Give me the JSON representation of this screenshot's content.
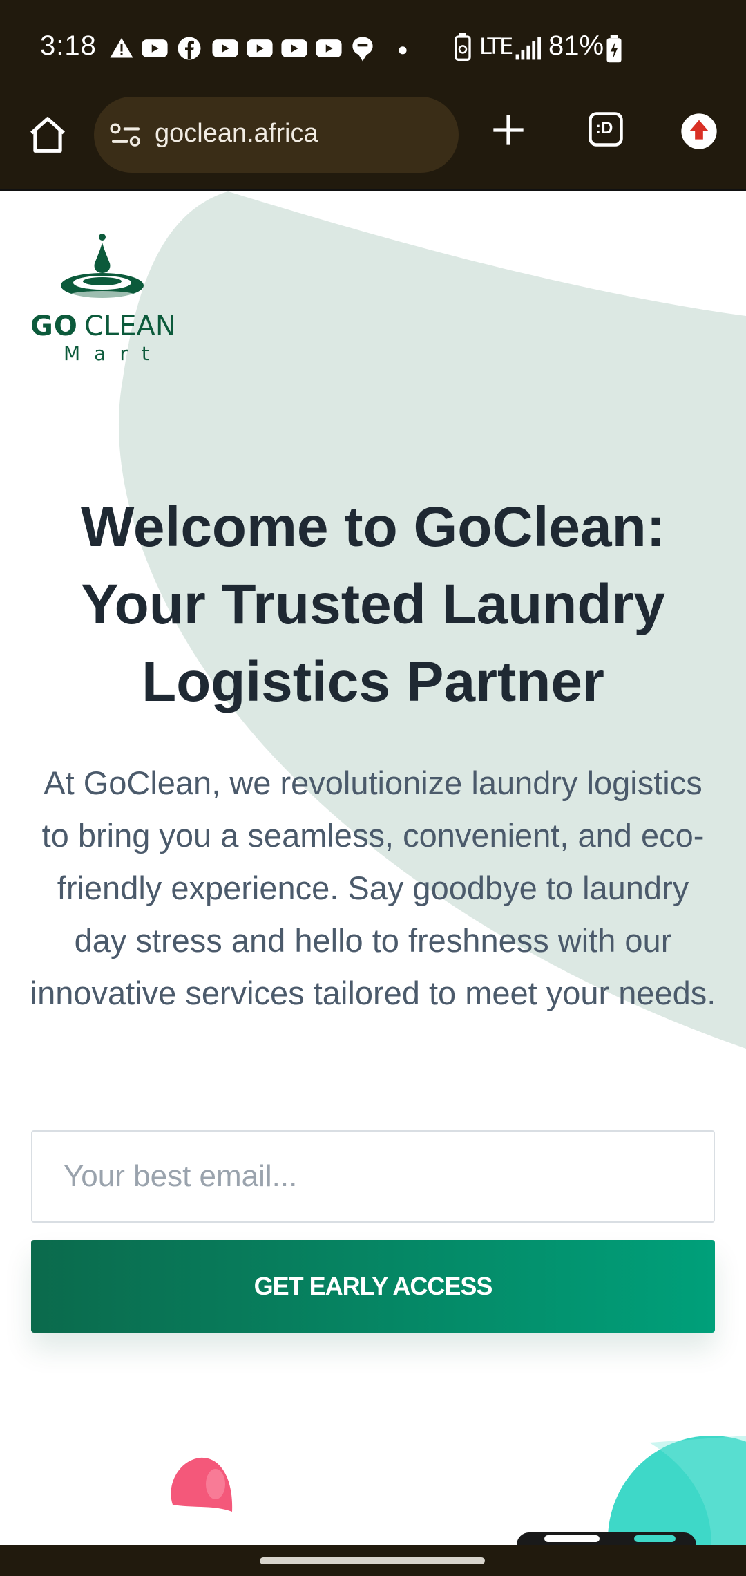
{
  "status_bar": {
    "time": "3:18",
    "notification_icons": [
      "warning-icon",
      "youtube-icon",
      "facebook-icon",
      "youtube-icon",
      "youtube-icon",
      "youtube-icon",
      "youtube-icon",
      "chat-icon",
      "more-dot-icon"
    ],
    "system_icons": [
      "battery-saver-icon",
      "lte-icon",
      "signal-icon",
      "battery-charging-icon"
    ],
    "network_label": "LTE",
    "battery": "81%"
  },
  "browser": {
    "url": "goclean.africa",
    "tabs_label": ":D",
    "icons": [
      "home-icon",
      "site-info-icon",
      "plus-icon",
      "tabs-icon",
      "upload-icon"
    ],
    "accent_color": "#d93025"
  },
  "page": {
    "logo": {
      "word1": "GO",
      "word2": "CLEAN",
      "word3": "Mart",
      "color": "#0c5a3b"
    },
    "hero": {
      "title": "Welcome to GoClean: Your Trusted Laundry Logistics Partner",
      "subtitle": "At GoClean, we revolutionize laundry logistics to bring you a seamless, convenient, and eco-friendly experience. Say goodbye to laundry day stress and hello to freshness with our innovative services tailored to meet your needs."
    },
    "form": {
      "email_placeholder": "Your best email...",
      "email_value": "",
      "cta_label": "GET EARLY ACCESS",
      "cta_color_start": "#0b6a4c",
      "cta_color_end": "#00a07a"
    },
    "colors": {
      "blob": "#dce8e3",
      "title": "#1f2933",
      "text": "#4b5a6b",
      "pink": "#f4587a",
      "teal": "#3ed8c8"
    }
  }
}
